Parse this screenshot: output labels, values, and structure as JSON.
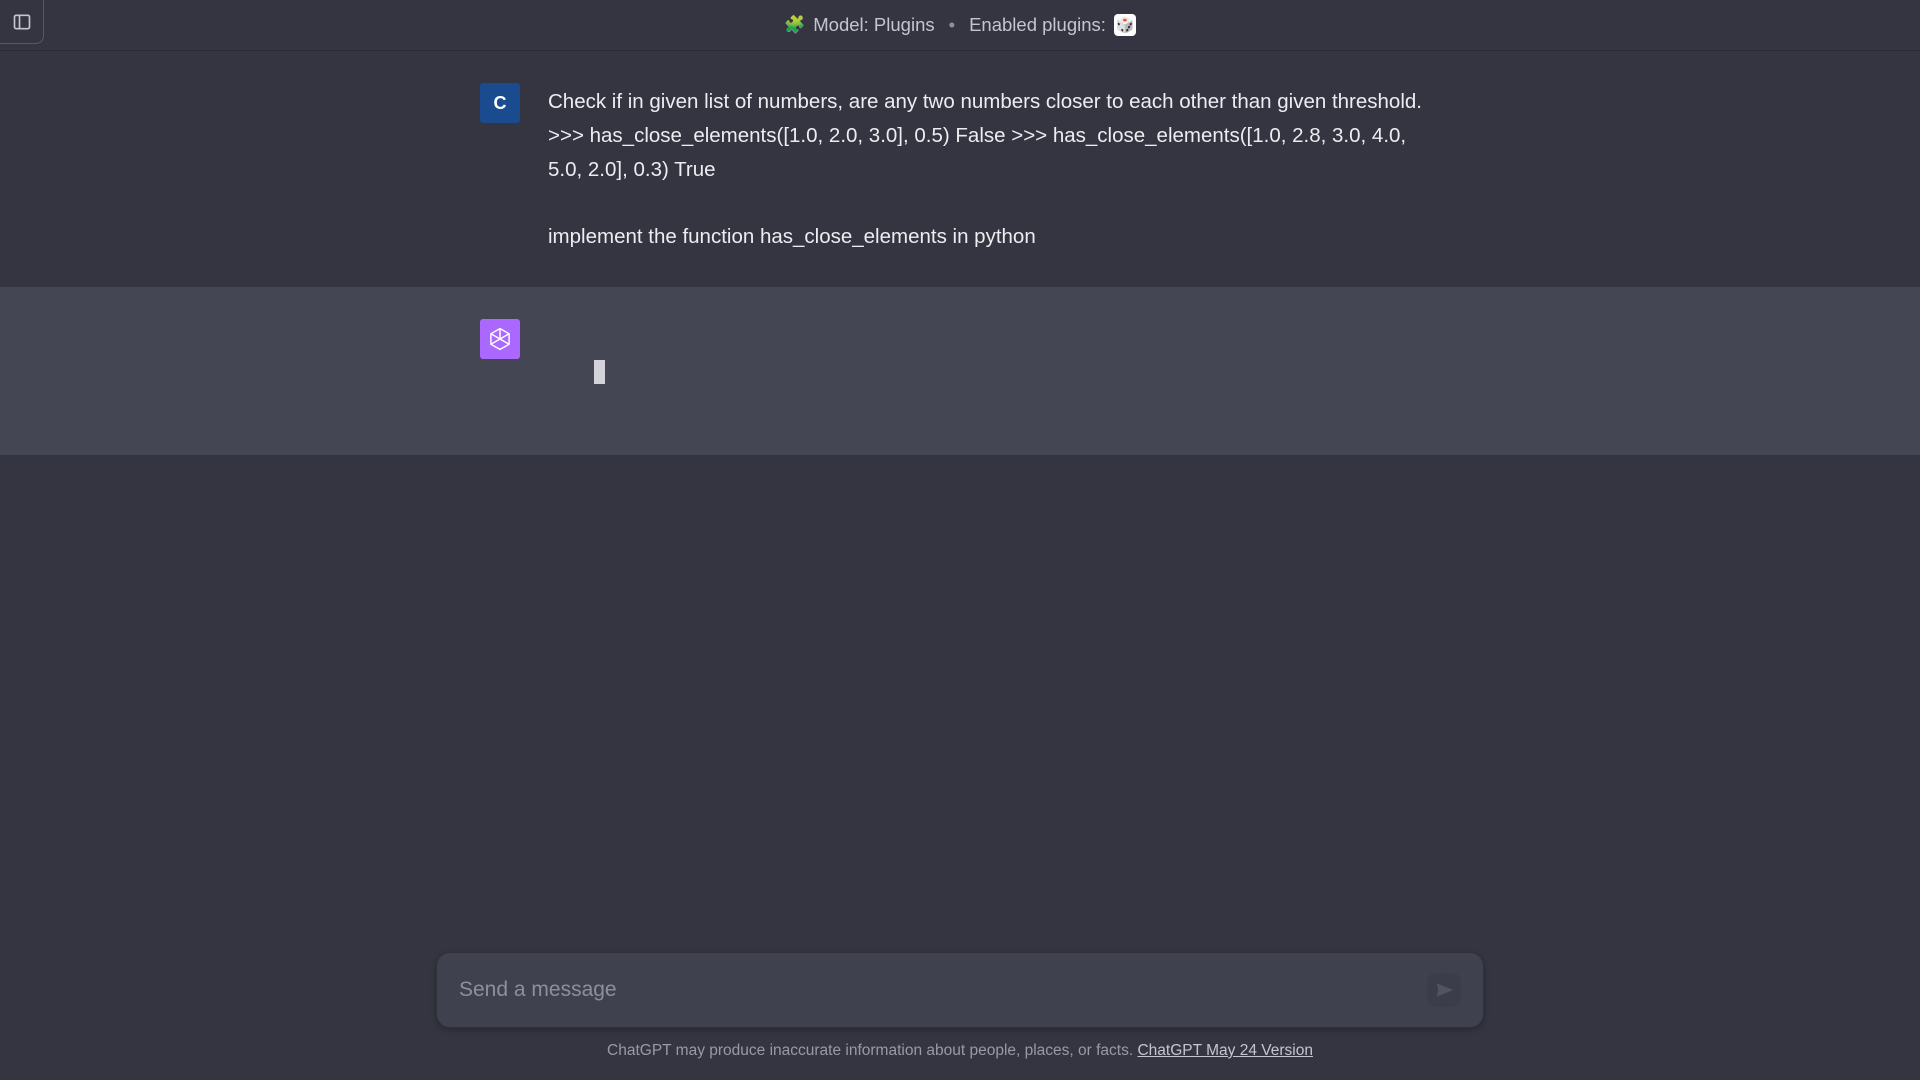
{
  "header": {
    "puzzle_icon": "🧩",
    "model_label": "Model: Plugins",
    "separator": "•",
    "enabled_label": "Enabled plugins:",
    "enabled_badge_glyph": "🎲"
  },
  "messages": {
    "user": {
      "avatar_letter": "C",
      "text": "Check if in given list of numbers, are any two numbers closer to each other than given threshold. >>> has_close_elements([1.0, 2.0, 3.0], 0.5) False >>> has_close_elements([1.0, 2.8, 3.0, 4.0, 5.0, 2.0], 0.3) True\n\nimplement the function has_close_elements in python"
    },
    "assistant": {
      "text": ""
    }
  },
  "compose": {
    "placeholder": "Send a message"
  },
  "footer": {
    "disclaimer": "ChatGPT may produce inaccurate information about people, places, or facts. ",
    "version_link": "ChatGPT May 24 Version"
  },
  "colors": {
    "bg": "#343541",
    "assistant_bg": "#444654",
    "user_avatar": "#1a4b8e",
    "bot_avatar": "#ab68ff"
  }
}
